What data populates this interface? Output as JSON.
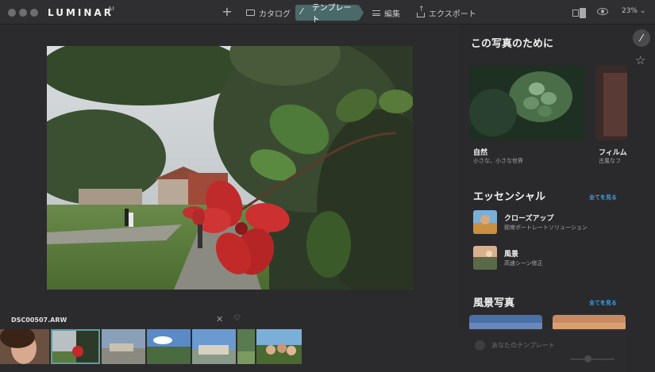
{
  "app": {
    "logo": "LUMINAR",
    "logo_suffix": "AI"
  },
  "toolbar": {
    "add_label": "+",
    "tabs": [
      {
        "label": "カタログ",
        "icon": "folder-icon"
      },
      {
        "label": "テンプレート",
        "icon": "magic-wand-icon",
        "active": true
      },
      {
        "label": "編集",
        "icon": "sliders-icon"
      },
      {
        "label": "エクスポート",
        "icon": "export-icon"
      }
    ],
    "zoom": "23%"
  },
  "canvas": {
    "filename": "DSC00507.ARW"
  },
  "panel": {
    "for_this_photo_title": "この写真のために",
    "featured": [
      {
        "title": "自然",
        "subtitle": "小さな、小さな世界"
      },
      {
        "title": "フィルム",
        "subtitle": "古風なフ"
      }
    ],
    "essentials": {
      "title": "エッセンシャル",
      "see_all": "全てを見る",
      "items": [
        {
          "title": "クローズアップ",
          "subtitle": "即席ポートレートソリューション"
        },
        {
          "title": "風景",
          "subtitle": "高速シーン修正"
        }
      ]
    },
    "landscape": {
      "title": "風景写真",
      "see_all": "全てを見る"
    },
    "my_templates_label": "あなたのテンプレート"
  },
  "colors": {
    "accent": "#3b9bec",
    "active_tab": "#4a6a6a",
    "background": "#2a2a2c"
  }
}
